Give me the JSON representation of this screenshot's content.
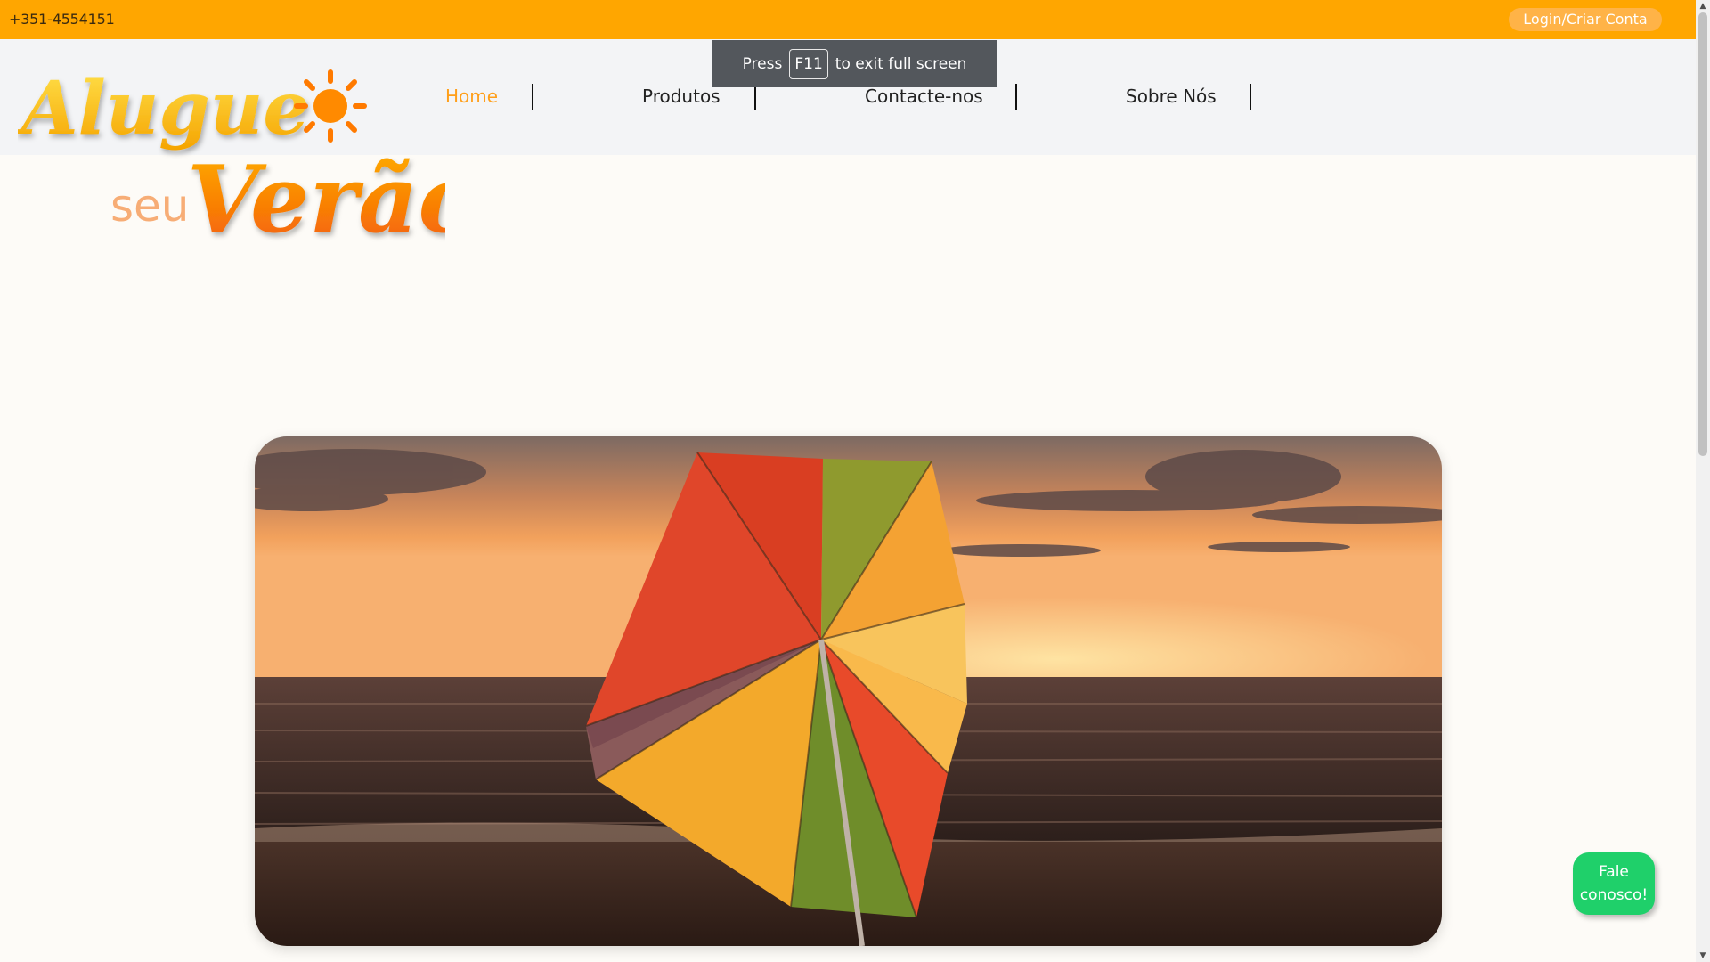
{
  "topbar": {
    "phone": "+351-4554151",
    "login_label": "Login/Criar Conta"
  },
  "logo": {
    "line1": "Alugue",
    "line2_small": "seu",
    "line2_big": "Verão"
  },
  "nav": {
    "items": [
      {
        "label": "Home",
        "active": true
      },
      {
        "label": "Produtos",
        "active": false
      },
      {
        "label": "Contacte-nos",
        "active": false
      },
      {
        "label": "Sobre Nós",
        "active": false
      }
    ]
  },
  "fullscreen_toast": {
    "prefix": "Press",
    "key": "F11",
    "suffix": "to exit full screen"
  },
  "hero": {
    "image": "beach-umbrella-sunset-image"
  },
  "chat": {
    "label_line1": "Fale",
    "label_line2": "conosco!"
  },
  "colors": {
    "topbar": "#ffa600",
    "active_nav": "#ff9f1a",
    "chat_button": "#1fd06a",
    "header_bg": "#f3f4f6",
    "page_bg": "#fdfbf7"
  }
}
